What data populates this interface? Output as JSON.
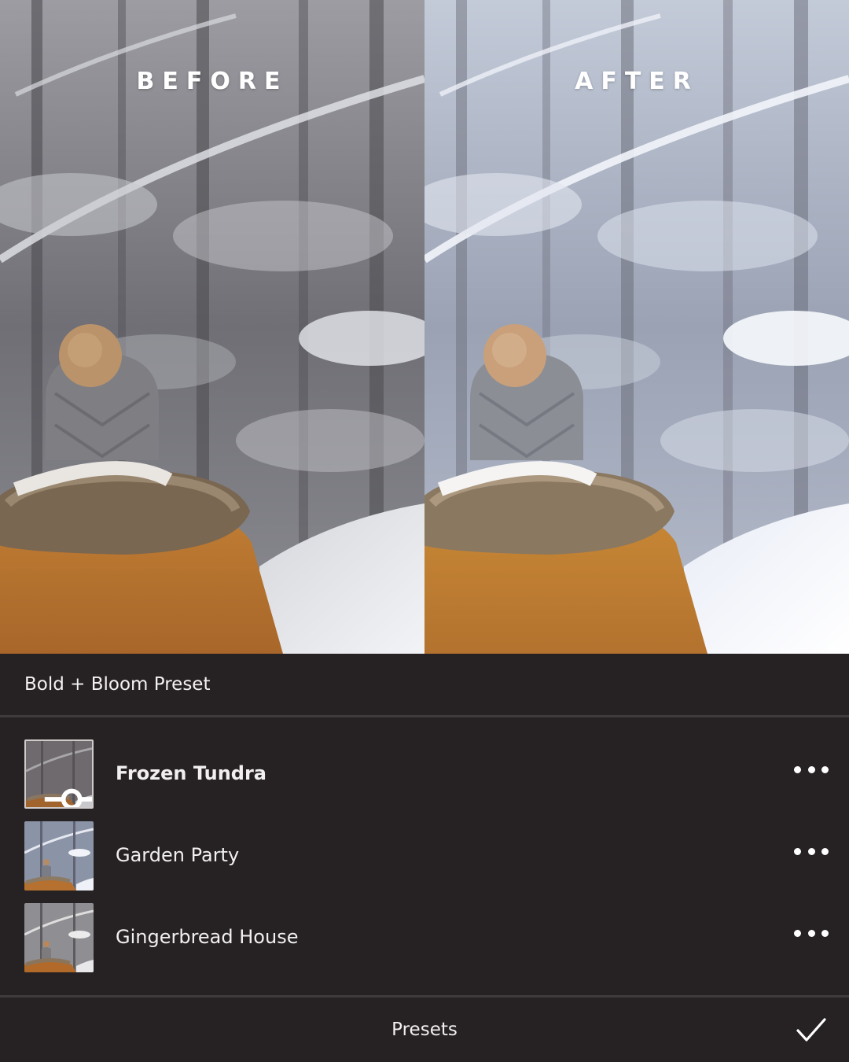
{
  "comparison": {
    "before_label": "BEFORE",
    "after_label": "AFTER"
  },
  "group": {
    "title": "Bold + Bloom Preset"
  },
  "presets": [
    {
      "name": "Frozen Tundra",
      "selected": true
    },
    {
      "name": "Garden Party",
      "selected": false
    },
    {
      "name": "Gingerbread House",
      "selected": false
    }
  ],
  "footer": {
    "title": "Presets"
  },
  "icons": {
    "more": "more-horizontal-icon",
    "confirm": "checkmark-icon",
    "adjust": "slider-adjust-icon"
  },
  "colors": {
    "background": "#262223",
    "divider": "#3f3b3c",
    "text": "#f1efef",
    "jacket": "#b8772e",
    "hat": "#8a8a8c",
    "pompom": "#c49a6c"
  }
}
